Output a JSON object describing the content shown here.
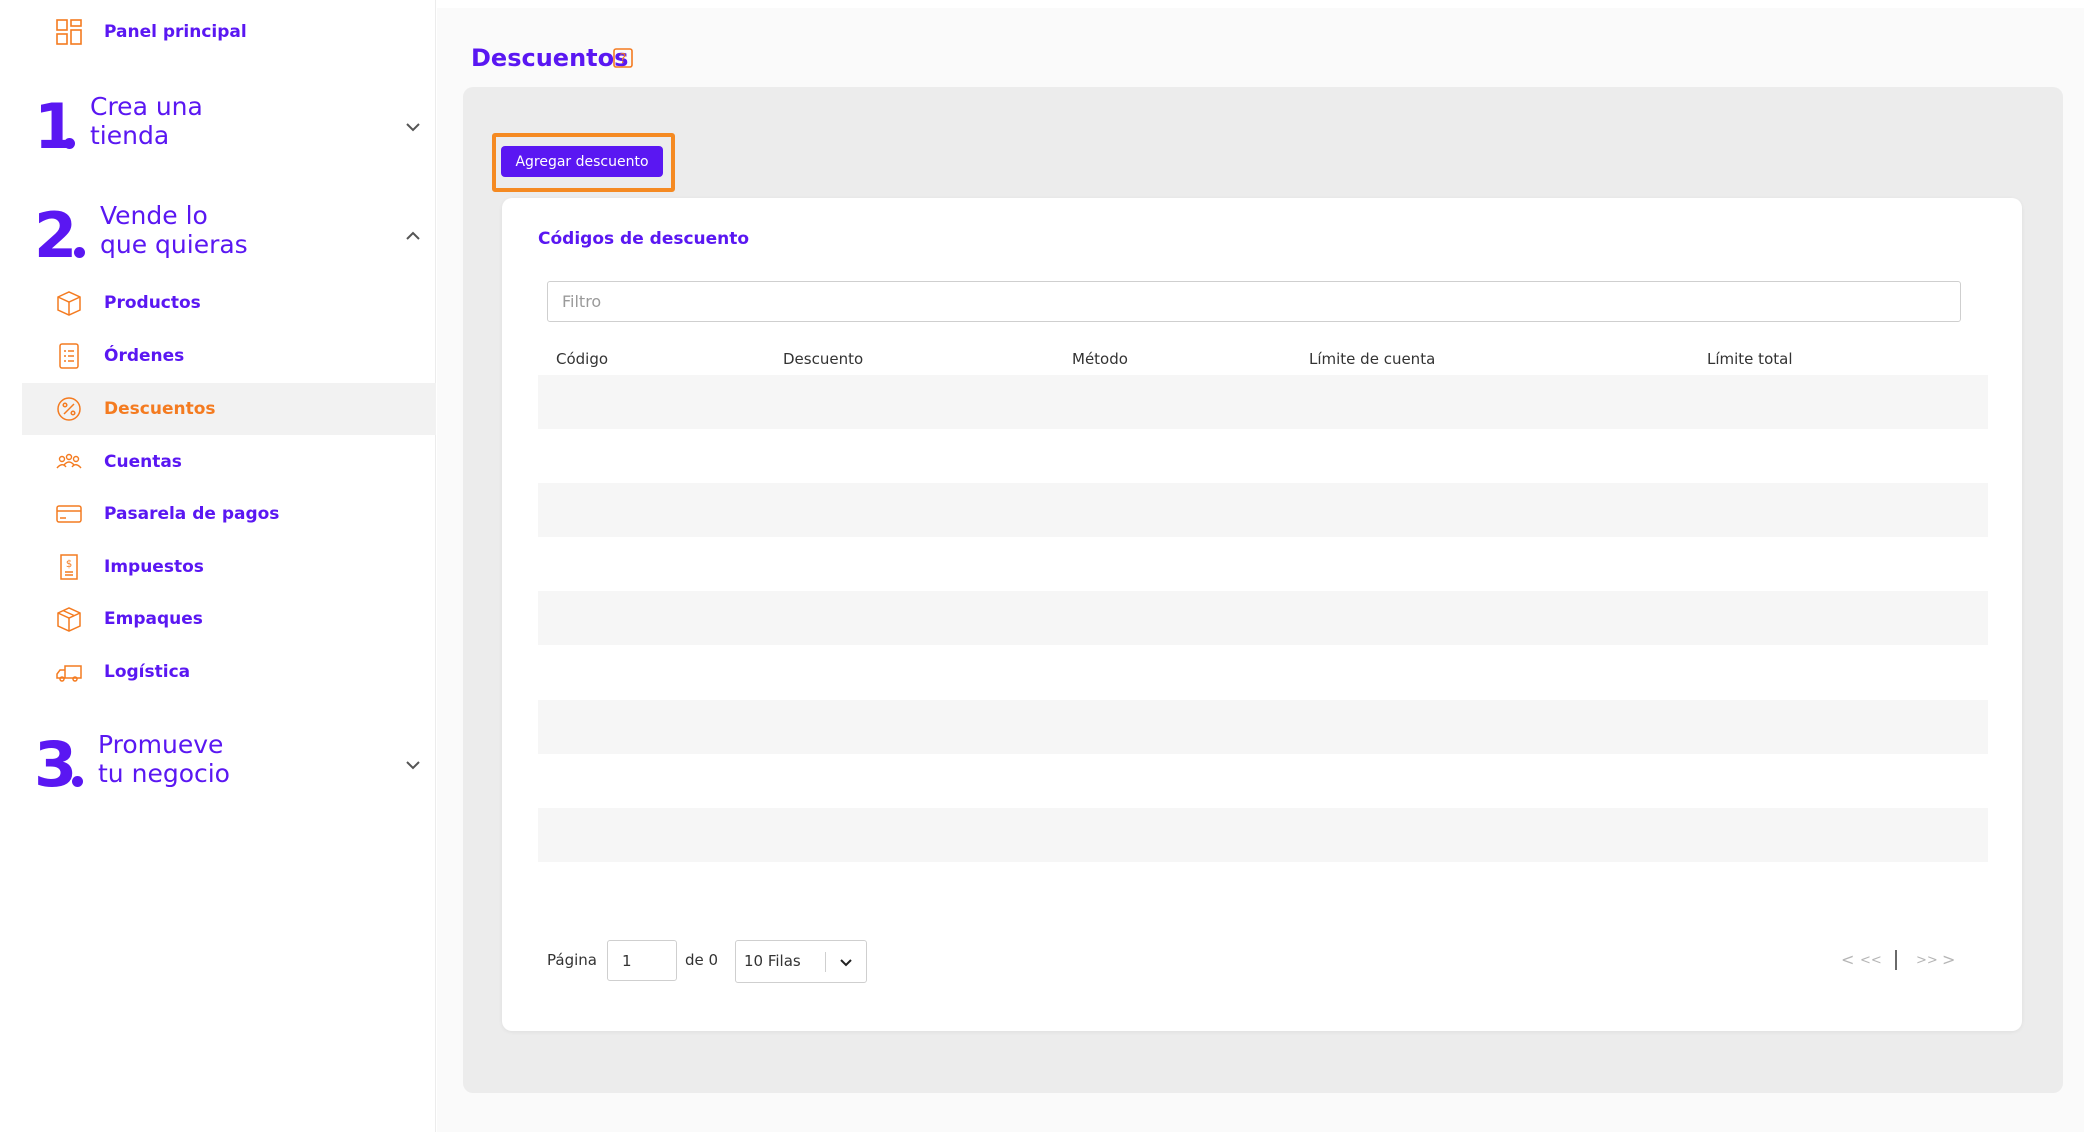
{
  "sidebar": {
    "dashboard": {
      "label": "Panel principal",
      "icon": "dashboard-icon"
    },
    "sections": [
      {
        "number": "1",
        "title_line1": "Crea una",
        "title_line2": "tienda",
        "state": "collapsed"
      },
      {
        "number": "2",
        "title_line1": "Vende lo",
        "title_line2": "que quieras",
        "state": "expanded"
      },
      {
        "number": "3",
        "title_line1": "Promueve",
        "title_line2": "tu negocio",
        "state": "collapsed"
      }
    ],
    "items": [
      {
        "label": "Productos",
        "icon": "box-icon"
      },
      {
        "label": "Órdenes",
        "icon": "clipboard-list-icon"
      },
      {
        "label": "Descuentos",
        "icon": "percent-badge-icon",
        "active": true
      },
      {
        "label": "Cuentas",
        "icon": "users-icon"
      },
      {
        "label": "Pasarela de pagos",
        "icon": "credit-card-icon"
      },
      {
        "label": "Impuestos",
        "icon": "receipt-icon"
      },
      {
        "label": "Empaques",
        "icon": "package-icon"
      },
      {
        "label": "Logística",
        "icon": "truck-icon"
      }
    ]
  },
  "page": {
    "title": "Descuentos",
    "help_icon": "help-icon"
  },
  "toolbar": {
    "add_label": "Agregar descuento"
  },
  "table": {
    "title": "Códigos de descuento",
    "filter_placeholder": "Filtro",
    "columns": [
      "Código",
      "Descuento",
      "Método",
      "Límite de cuenta",
      "Límite total"
    ],
    "rows": []
  },
  "pagination": {
    "page_label": "Página",
    "current_page": "1",
    "of_label": "de 0",
    "rows_option": "10 Filas",
    "prev": "<",
    "first": "<<",
    "last": ">>",
    "next": ">"
  },
  "colors": {
    "brand": "#5a17f2",
    "active": "#f47b20",
    "highlight": "#f58a22"
  }
}
